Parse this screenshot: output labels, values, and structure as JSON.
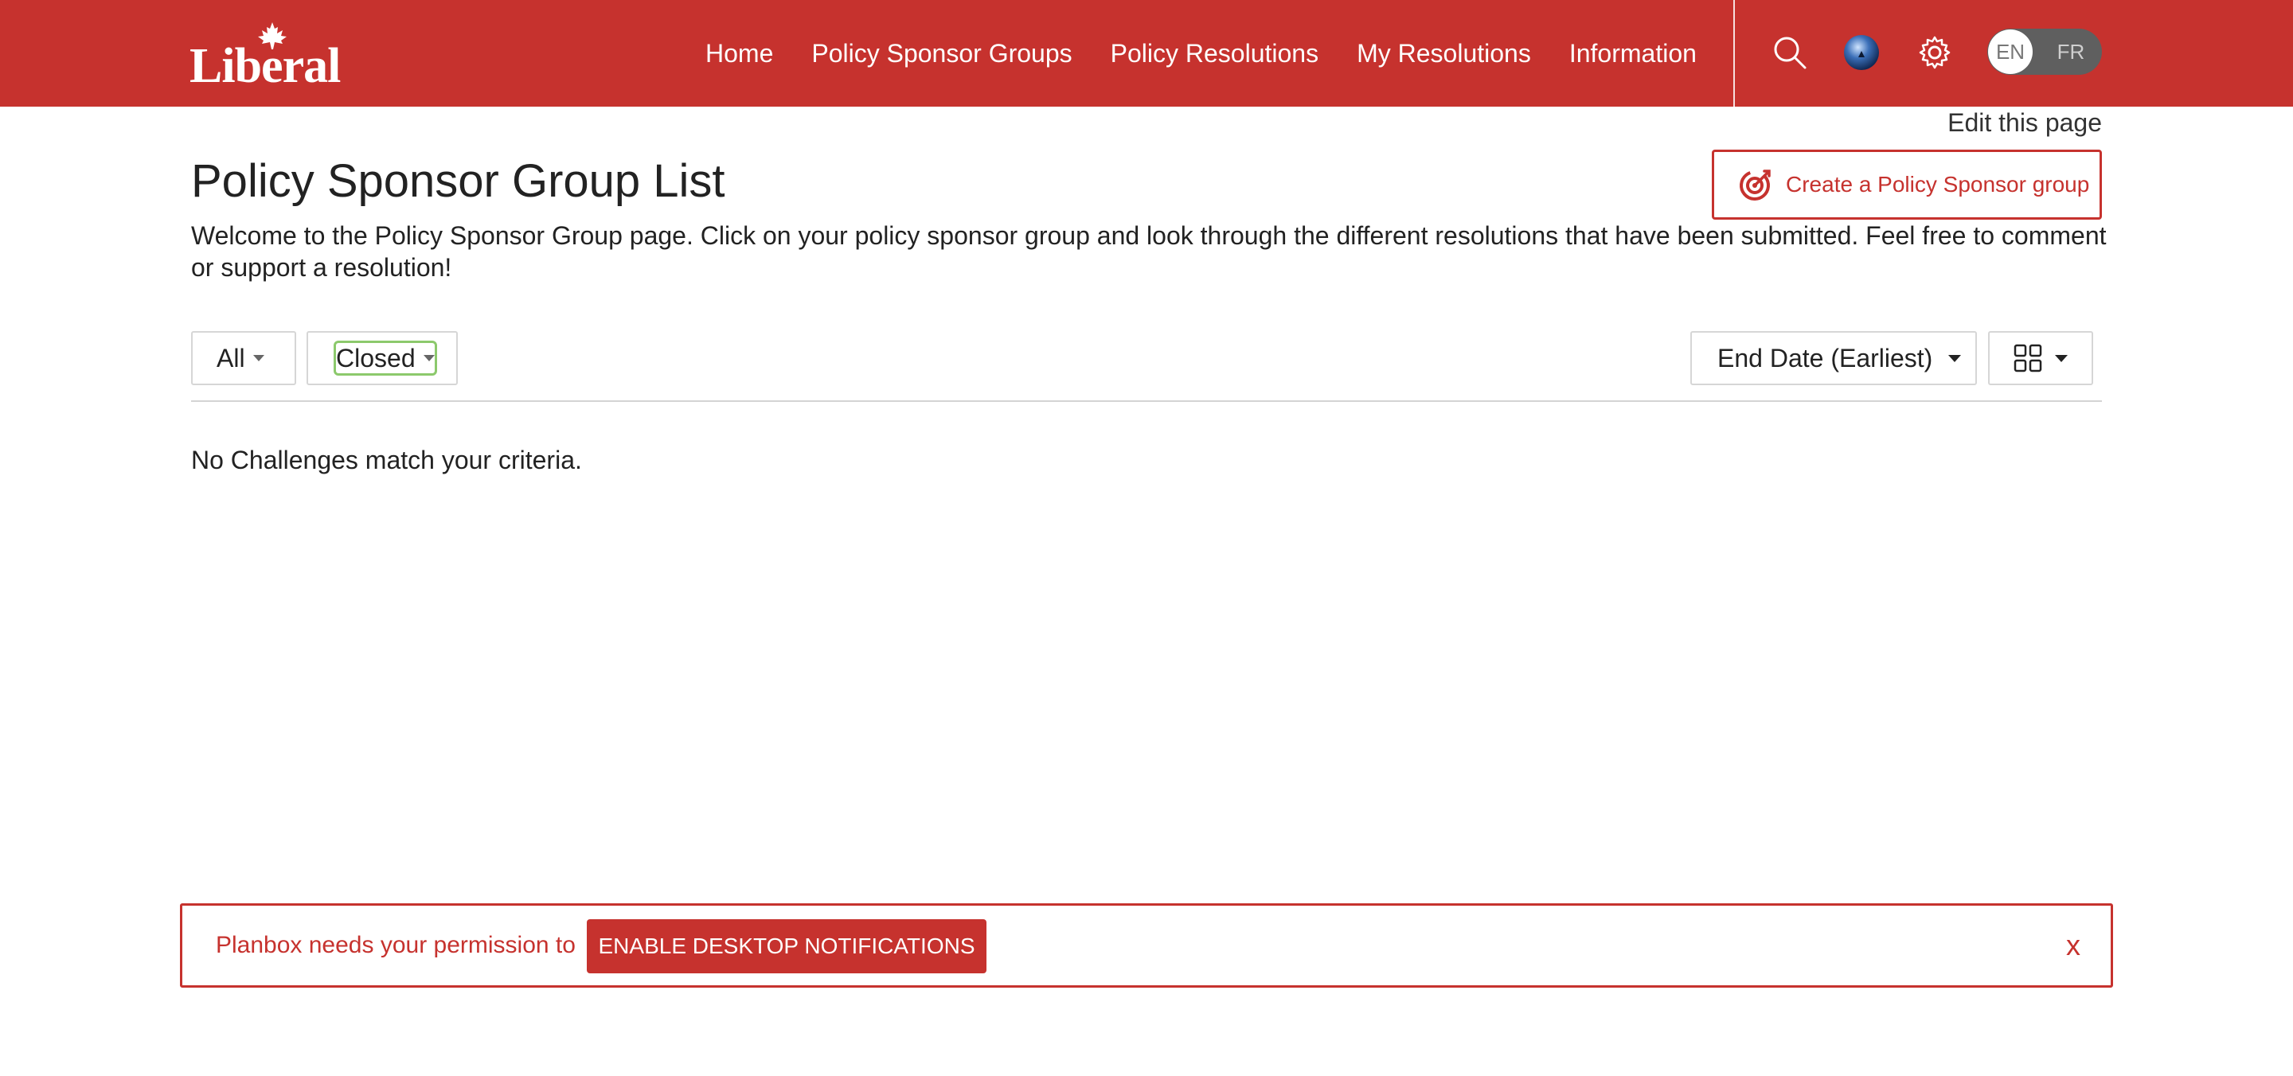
{
  "header": {
    "logo_text": "Liberal",
    "nav": [
      "Home",
      "Policy Sponsor Groups",
      "Policy Resolutions",
      "My Resolutions",
      "Information"
    ],
    "lang_en": "EN",
    "lang_fr": "FR"
  },
  "page": {
    "edit_link": "Edit this page",
    "title": "Policy Sponsor Group List",
    "create_button": "Create a Policy Sponsor group",
    "intro": "Welcome to the Policy Sponsor Group page. Click on your policy sponsor group and look through the different resolutions that have been submitted. Feel free to comment or support a resolution!"
  },
  "filters": {
    "scope": "All",
    "status": "Closed",
    "sort": "End Date (Earliest)"
  },
  "results": {
    "empty_message": "No Challenges match your criteria."
  },
  "notification": {
    "text": "Planbox needs your permission to",
    "button": "ENABLE DESKTOP NOTIFICATIONS",
    "close": "x"
  },
  "colors": {
    "brand_red": "#c6322e",
    "focus_green": "#8cc96c"
  }
}
